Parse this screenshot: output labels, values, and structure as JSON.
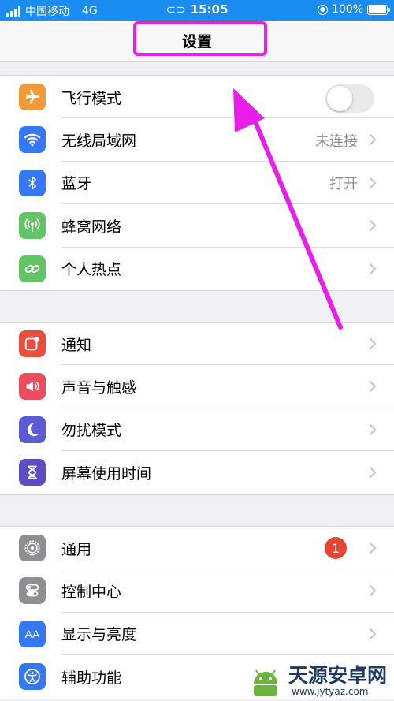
{
  "status_bar": {
    "carrier": "中国移动",
    "network": "4G",
    "time": "15:05",
    "battery": "100%",
    "battery_level": 1.0
  },
  "nav": {
    "title": "设置"
  },
  "groups": [
    {
      "items": [
        {
          "label": "飞行模式",
          "icon": "airplane-icon",
          "color": "#f19a37",
          "control": "toggle",
          "toggle_on": false
        },
        {
          "label": "无线局域网",
          "icon": "wifi-icon",
          "color": "#3478f6",
          "value": "未连接"
        },
        {
          "label": "蓝牙",
          "icon": "bluetooth-icon",
          "color": "#3478f6",
          "value": "打开"
        },
        {
          "label": "蜂窝网络",
          "icon": "cellular-icon",
          "color": "#63c466"
        },
        {
          "label": "个人热点",
          "icon": "hotspot-icon",
          "color": "#63c466"
        }
      ]
    },
    {
      "items": [
        {
          "label": "通知",
          "icon": "notification-icon",
          "color": "#eb4d3d"
        },
        {
          "label": "声音与触感",
          "icon": "speaker-icon",
          "color": "#eb4d5f"
        },
        {
          "label": "勿扰模式",
          "icon": "moon-icon",
          "color": "#5b5bd6"
        },
        {
          "label": "屏幕使用时间",
          "icon": "hourglass-icon",
          "color": "#5b4ec4"
        }
      ]
    },
    {
      "items": [
        {
          "label": "通用",
          "icon": "gear-icon",
          "color": "#8e8e93",
          "badge": "1"
        },
        {
          "label": "控制中心",
          "icon": "switches-icon",
          "color": "#8e8e93"
        },
        {
          "label": "显示与亮度",
          "icon": "text-size-icon",
          "color": "#3478f6"
        },
        {
          "label": "辅助功能",
          "icon": "accessibility-icon",
          "color": "#3478f6"
        }
      ]
    }
  ],
  "annotation": {
    "highlight_color": "#e91ee8"
  },
  "watermark": {
    "text": "天源安卓网",
    "url": "www.jytyaz.com"
  }
}
